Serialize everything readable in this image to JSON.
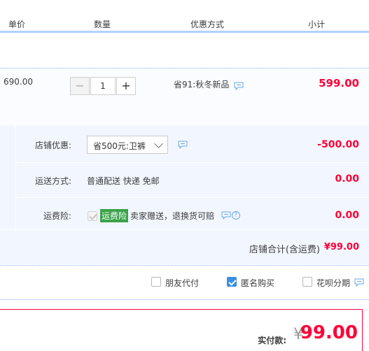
{
  "header": {
    "col_unit_price": "单价",
    "col_quantity": "数量",
    "col_promo": "优惠方式",
    "col_subtotal": "小计"
  },
  "item": {
    "unit_price": "690.00",
    "quantity": "1",
    "quantity_minus": "−",
    "quantity_plus": "+",
    "promo": "省91:秋冬新品",
    "subtotal": "599.00"
  },
  "shop": {
    "discount_label": "店铺优惠:",
    "discount_selected": "省500元:卫裤",
    "discount_amount": "-500.00",
    "shipping_label": "运送方式:",
    "shipping_method": "普通配送 快递 免邮",
    "shipping_amount": "0.00",
    "insurance_label": "运费险:",
    "insurance_badge": "运费险",
    "insurance_desc": "卖家赠送，退换货可赔",
    "insurance_amount": "0.00",
    "total_label": "店铺合计(含运费)",
    "total_value": "¥99.00"
  },
  "options": {
    "friend_pay": "朋友代付",
    "anonymous": "匿名购买",
    "huabei": "花呗分期",
    "anonymous_checked": true
  },
  "payment": {
    "label": "实付款:",
    "currency": "¥",
    "amount": "99.00"
  },
  "colors": {
    "accent_red": "#ff0036",
    "accent_blue": "#3a8ee6",
    "section_bg": "#f2f7ff"
  }
}
